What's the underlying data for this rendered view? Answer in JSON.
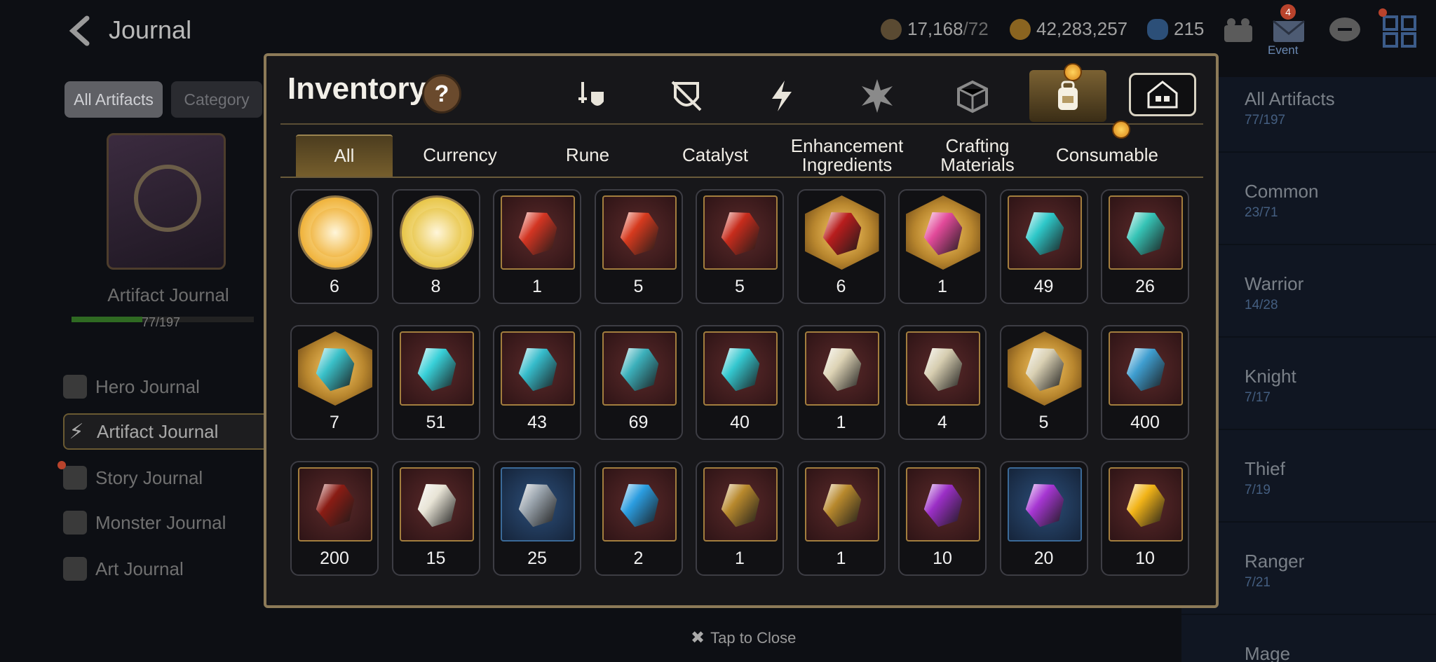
{
  "header": {
    "title": "Journal",
    "stamina": "17,168",
    "stamina_max": "/72",
    "gold": "42,283,257",
    "crystals": "215",
    "mail_badge": "4",
    "event_label": "Event"
  },
  "left": {
    "filter_all": "All Artifacts",
    "filter_category": "Category",
    "book_label": "Artifact Journal",
    "progress_text": "77/197",
    "progress_fraction": 0.39,
    "menu": [
      {
        "label": "Hero Journal",
        "icon": "hero-icon"
      },
      {
        "label": "Artifact Journal",
        "icon": "lightning-icon"
      },
      {
        "label": "Story Journal",
        "icon": "scroll-icon"
      },
      {
        "label": "Monster Journal",
        "icon": "dragon-icon"
      },
      {
        "label": "Art Journal",
        "icon": "brush-icon"
      }
    ]
  },
  "right": {
    "categories": [
      {
        "name": "All Artifacts",
        "count": "77/197"
      },
      {
        "name": "Common",
        "count": "23/71"
      },
      {
        "name": "Warrior",
        "count": "14/28"
      },
      {
        "name": "Knight",
        "count": "7/17"
      },
      {
        "name": "Thief",
        "count": "7/19"
      },
      {
        "name": "Ranger",
        "count": "7/21"
      },
      {
        "name": "Mage",
        "count": ""
      }
    ]
  },
  "modal": {
    "title": "Inventory",
    "help": "?",
    "type_tabs": [
      "sword-shield-icon",
      "broken-shield-icon",
      "lightning-icon",
      "starburst-icon",
      "dice-icon",
      "backpack-icon",
      "house-icon"
    ],
    "sub_tabs": [
      "All",
      "Currency",
      "Rune",
      "Catalyst",
      "Enhancement\nIngredients",
      "Crafting\nMaterials",
      "Consumable"
    ],
    "items": [
      {
        "icon": "yellow-cat-coin-icon",
        "qty": "6",
        "frame": "round",
        "color": "#f0b33c"
      },
      {
        "icon": "green-cat-coin-icon",
        "qty": "8",
        "frame": "round",
        "color": "#e8c64a"
      },
      {
        "icon": "red-potion-icon",
        "qty": "1",
        "frame": "square",
        "color": "#d33522"
      },
      {
        "icon": "red-t-rune-icon",
        "qty": "5",
        "frame": "square",
        "color": "#d63a1e"
      },
      {
        "icon": "red-sword-rune-icon",
        "qty": "5",
        "frame": "square",
        "color": "#c72c1c"
      },
      {
        "icon": "red-star-rune-icon",
        "qty": "6",
        "frame": "hex",
        "color": "#b81d1d"
      },
      {
        "icon": "pink-potion-icon",
        "qty": "1",
        "frame": "hex",
        "color": "#e24a9a"
      },
      {
        "icon": "cyan-spiral-rune-icon",
        "qty": "49",
        "frame": "square",
        "color": "#2ec8c9"
      },
      {
        "icon": "yellow-sword-rune-icon",
        "qty": "26",
        "frame": "square",
        "color": "#36c4b6"
      },
      {
        "icon": "cyan-star-rune-icon",
        "qty": "7",
        "frame": "hex",
        "color": "#3ac0c8"
      },
      {
        "icon": "cyan-boot-rune-icon",
        "qty": "51",
        "frame": "square",
        "color": "#38d0d8"
      },
      {
        "icon": "cyan-boot-rune-icon",
        "qty": "43",
        "frame": "square",
        "color": "#36bccb"
      },
      {
        "icon": "yellow-t-rune-icon",
        "qty": "69",
        "frame": "square",
        "color": "#3cb0bb"
      },
      {
        "icon": "cyan-sword-rune-icon",
        "qty": "40",
        "frame": "square",
        "color": "#34c7cf"
      },
      {
        "icon": "stone-spiral-rune-icon",
        "qty": "1",
        "frame": "square",
        "color": "#ddd3b5"
      },
      {
        "icon": "stone-sword-rune-icon",
        "qty": "4",
        "frame": "square",
        "color": "#d6cdb0"
      },
      {
        "icon": "stone-star-rune-icon",
        "qty": "5",
        "frame": "hex",
        "color": "#d9d0b3"
      },
      {
        "icon": "dark-shard-icon",
        "qty": "400",
        "frame": "square",
        "color": "#3f9ed0"
      },
      {
        "icon": "red-core-gem-icon",
        "qty": "200",
        "frame": "square",
        "color": "#8a1c14"
      },
      {
        "icon": "white-chest-icon",
        "qty": "15",
        "frame": "square",
        "color": "#e8e4d6"
      },
      {
        "icon": "silver-chest-icon",
        "qty": "25",
        "frame": "blue",
        "color": "#9aa4ad"
      },
      {
        "icon": "blue-chest-icon",
        "qty": "2",
        "frame": "square",
        "color": "#2b9de0"
      },
      {
        "icon": "gold-chest-icon",
        "qty": "1",
        "frame": "square",
        "color": "#b8892d"
      },
      {
        "icon": "gold-chest-icon",
        "qty": "1",
        "frame": "square",
        "color": "#b8892d"
      },
      {
        "icon": "purple-moon-gem-icon",
        "qty": "10",
        "frame": "square",
        "color": "#9b2fc6"
      },
      {
        "icon": "purple-moon-triangle-icon",
        "qty": "20",
        "frame": "blue",
        "color": "#a636d2"
      },
      {
        "icon": "gold-coin-icon",
        "qty": "10",
        "frame": "square",
        "color": "#f2b418"
      }
    ]
  },
  "footer": {
    "close_hint": "Tap to Close"
  }
}
